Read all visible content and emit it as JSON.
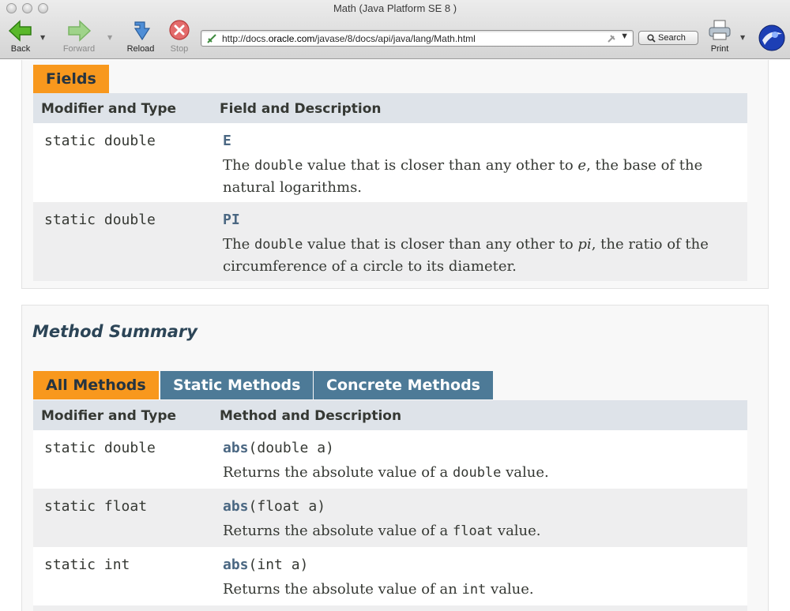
{
  "window": {
    "title": "Math (Java Platform SE 8 )"
  },
  "toolbar": {
    "back_label": "Back",
    "forward_label": "Forward",
    "reload_label": "Reload",
    "stop_label": "Stop",
    "print_label": "Print",
    "search_label": "Search"
  },
  "address": {
    "url_prefix": "http://docs.",
    "url_domain": "oracle.com",
    "url_path": "/javase/8/docs/api/java/lang/Math.html"
  },
  "fields": {
    "caption": "Fields",
    "col1": "Modifier and Type",
    "col2": "Field and Description",
    "rows": [
      {
        "modifier": "static double",
        "name": "E",
        "desc_pre": "The ",
        "desc_code": "double",
        "desc_mid": " value that is closer than any other to ",
        "desc_em": "e",
        "desc_post": ", the base of the natural logarithms."
      },
      {
        "modifier": "static double",
        "name": "PI",
        "desc_pre": "The ",
        "desc_code": "double",
        "desc_mid": " value that is closer than any other to ",
        "desc_em": "pi",
        "desc_post": ", the ratio of the circumference of a circle to its diameter."
      }
    ]
  },
  "methods": {
    "heading": "Method Summary",
    "tabs": [
      {
        "label": "All Methods",
        "active": true
      },
      {
        "label": "Static Methods",
        "active": false
      },
      {
        "label": "Concrete Methods",
        "active": false
      }
    ],
    "col1": "Modifier and Type",
    "col2": "Method and Description",
    "rows": [
      {
        "modifier": "static double",
        "name": "abs",
        "params": "(double a)",
        "desc_pre": "Returns the absolute value of a ",
        "desc_code": "double",
        "desc_post": " value."
      },
      {
        "modifier": "static float",
        "name": "abs",
        "params": "(float a)",
        "desc_pre": "Returns the absolute value of a ",
        "desc_code": "float",
        "desc_post": " value."
      },
      {
        "modifier": "static int",
        "name": "abs",
        "params": "(int a)",
        "desc_pre": "Returns the absolute value of an ",
        "desc_code": "int",
        "desc_post": " value."
      }
    ]
  },
  "colors": {
    "accent_tab": "#f8981d",
    "inactive_tab": "#4d7a97",
    "table_header": "#dee3e9",
    "link": "#4a6782"
  }
}
